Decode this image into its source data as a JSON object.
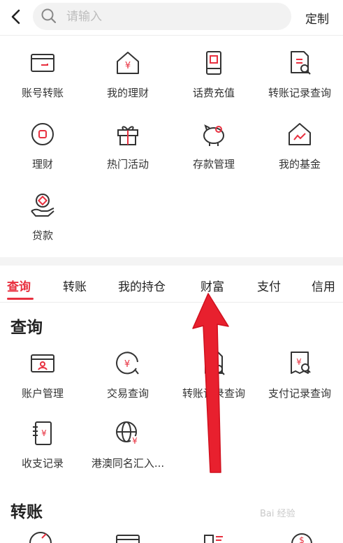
{
  "header": {
    "search_placeholder": "请输入",
    "custom_label": "定制"
  },
  "colors": {
    "accent": "#e8303f",
    "icon_dark": "#333333"
  },
  "top_grid": [
    {
      "label": "账号转账",
      "icon": "card-icon"
    },
    {
      "label": "我的理财",
      "icon": "home-yuan-icon"
    },
    {
      "label": "话费充值",
      "icon": "phone-icon"
    },
    {
      "label": "转账记录查询",
      "icon": "record-search-icon"
    },
    {
      "label": "理财",
      "icon": "coin-icon"
    },
    {
      "label": "热门活动",
      "icon": "gift-icon"
    },
    {
      "label": "存款管理",
      "icon": "piggy-bank-icon"
    },
    {
      "label": "我的基金",
      "icon": "fund-house-icon"
    },
    {
      "label": "贷款",
      "icon": "loan-hand-icon"
    }
  ],
  "tabs": [
    {
      "label": "查询",
      "active": true
    },
    {
      "label": "转账",
      "active": false
    },
    {
      "label": "我的持仓",
      "active": false
    },
    {
      "label": "财富",
      "active": false
    },
    {
      "label": "支付",
      "active": false
    },
    {
      "label": "信用",
      "active": false
    }
  ],
  "query_section": {
    "title": "查询",
    "items": [
      {
        "label": "账户管理",
        "icon": "account-card-icon"
      },
      {
        "label": "交易查询",
        "icon": "trade-search-icon"
      },
      {
        "label": "转账记录查询",
        "icon": "transfer-record-icon"
      },
      {
        "label": "支付记录查询",
        "icon": "pay-record-icon"
      },
      {
        "label": "收支记录",
        "icon": "ledger-icon"
      },
      {
        "label": "港澳同名汇入...",
        "icon": "globe-yuan-icon"
      }
    ]
  },
  "transfer_section": {
    "title": "转账"
  },
  "watermark": "Bai 经验"
}
